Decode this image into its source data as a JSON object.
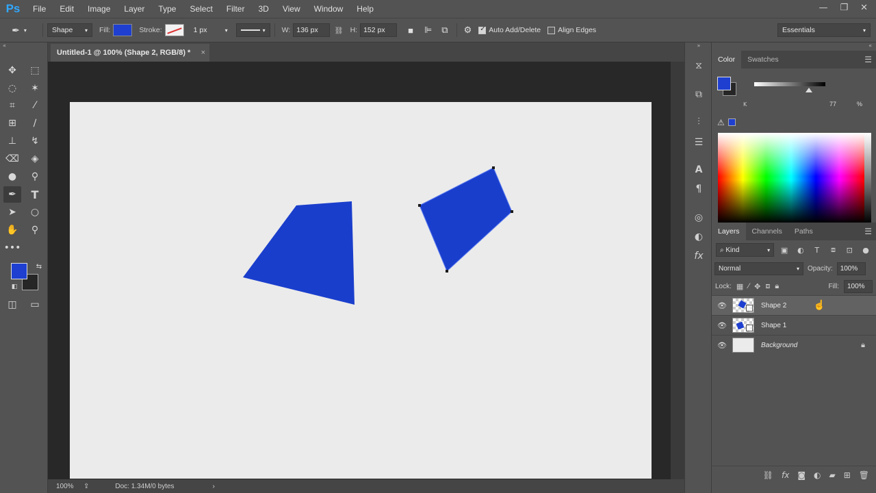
{
  "app": {
    "logo": "Ps"
  },
  "menu": [
    "File",
    "Edit",
    "Image",
    "Layer",
    "Type",
    "Select",
    "Filter",
    "3D",
    "View",
    "Window",
    "Help"
  ],
  "window_controls": {
    "minimize": "—",
    "restore": "❐",
    "close": "✕"
  },
  "options": {
    "tool_mode": "Shape",
    "fill_label": "Fill:",
    "stroke_label": "Stroke:",
    "stroke_width": "1 px",
    "w_label": "W:",
    "w_value": "136 px",
    "h_label": "H:",
    "h_value": "152 px",
    "auto_add_delete": "Auto Add/Delete",
    "auto_add_delete_checked": true,
    "align_edges": "Align Edges",
    "align_edges_checked": false,
    "workspace": "Essentials",
    "fill_color": "#1e3fd0"
  },
  "document": {
    "tab_title": "Untitled-1 @ 100% (Shape 2, RGB/8) *",
    "tab_close": "×",
    "zoom": "100%",
    "doc_info": "Doc: 1.34M/0 bytes",
    "shape_color": "#1a3ecc"
  },
  "color_panel": {
    "tabs": [
      "Color",
      "Swatches"
    ],
    "k_label": "K",
    "k_value": "77",
    "k_percent": "%"
  },
  "layers_panel": {
    "tabs": [
      "Layers",
      "Channels",
      "Paths"
    ],
    "kind": "Kind",
    "blend_mode": "Normal",
    "opacity_label": "Opacity:",
    "opacity_value": "100%",
    "lock_label": "Lock:",
    "fill_label": "Fill:",
    "fill_value": "100%",
    "layers": [
      {
        "name": "Shape 2",
        "selected": true
      },
      {
        "name": "Shape 1",
        "selected": false
      },
      {
        "name": "Background",
        "selected": false
      }
    ]
  }
}
